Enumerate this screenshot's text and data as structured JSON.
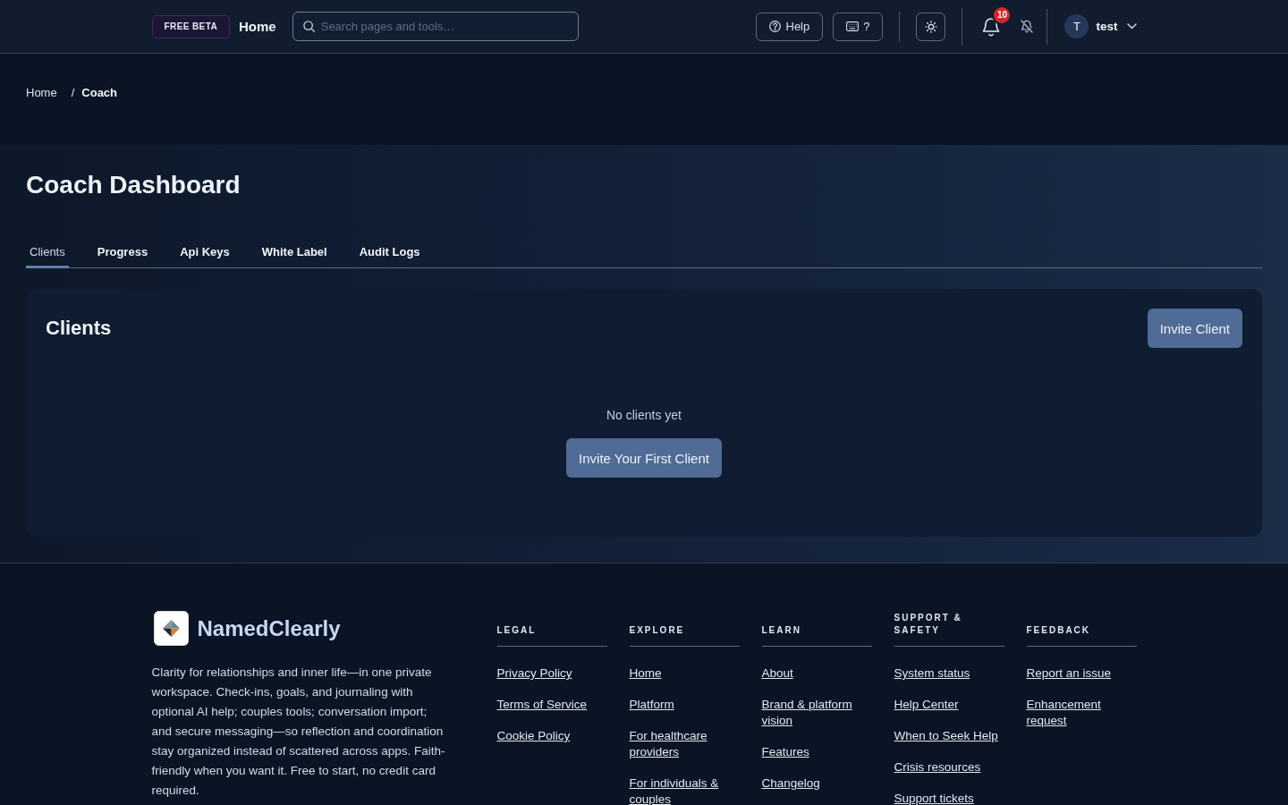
{
  "header": {
    "badge": "FREE BETA",
    "title": "Home",
    "search": {
      "placeholder": "Search pages and tools…"
    },
    "help_button": "Help",
    "shortcuts_button": "?",
    "notifications": {
      "count": "10"
    },
    "user": {
      "initial": "T",
      "name": "test"
    }
  },
  "breadcrumb": {
    "separator": "/",
    "items": [
      {
        "label": "Home",
        "current": false
      },
      {
        "label": "Coach",
        "current": true
      }
    ]
  },
  "page": {
    "title": "Coach Dashboard",
    "tabs": [
      {
        "label": "Clients",
        "selected": true
      },
      {
        "label": "Progress",
        "selected": false
      },
      {
        "label": "Api Keys",
        "selected": false
      },
      {
        "label": "White Label",
        "selected": false
      },
      {
        "label": "Audit Logs",
        "selected": false
      }
    ]
  },
  "clients_card": {
    "title": "Clients",
    "invite_button": "Invite Client",
    "empty_message": "No clients yet",
    "empty_button": "Invite Your First Client"
  },
  "footer": {
    "brand": "NamedClearly",
    "description": "Clarity for relationships and inner life—in one private workspace. Check-ins, goals, and journaling with optional AI help; couples tools; conversation import; and secure messaging—so reflection and coordination stay organized instead of scattered across apps. Faith-friendly when you want it. Free to start, no credit card required.",
    "columns": [
      {
        "heading": "LEGAL",
        "links": [
          "Privacy Policy",
          "Terms of Service",
          "Cookie Policy"
        ]
      },
      {
        "heading": "EXPLORE",
        "links": [
          "Home",
          "Platform",
          "For healthcare providers",
          "For individuals & couples"
        ]
      },
      {
        "heading": "LEARN",
        "links": [
          "About",
          "Brand & platform vision",
          "Features",
          "Changelog"
        ]
      },
      {
        "heading": "SUPPORT & SAFETY",
        "links": [
          "System status",
          "Help Center",
          "When to Seek Help",
          "Crisis resources",
          "Support tickets"
        ]
      },
      {
        "heading": "FEEDBACK",
        "links": [
          "Report an issue",
          "Enhancement request"
        ]
      }
    ]
  }
}
